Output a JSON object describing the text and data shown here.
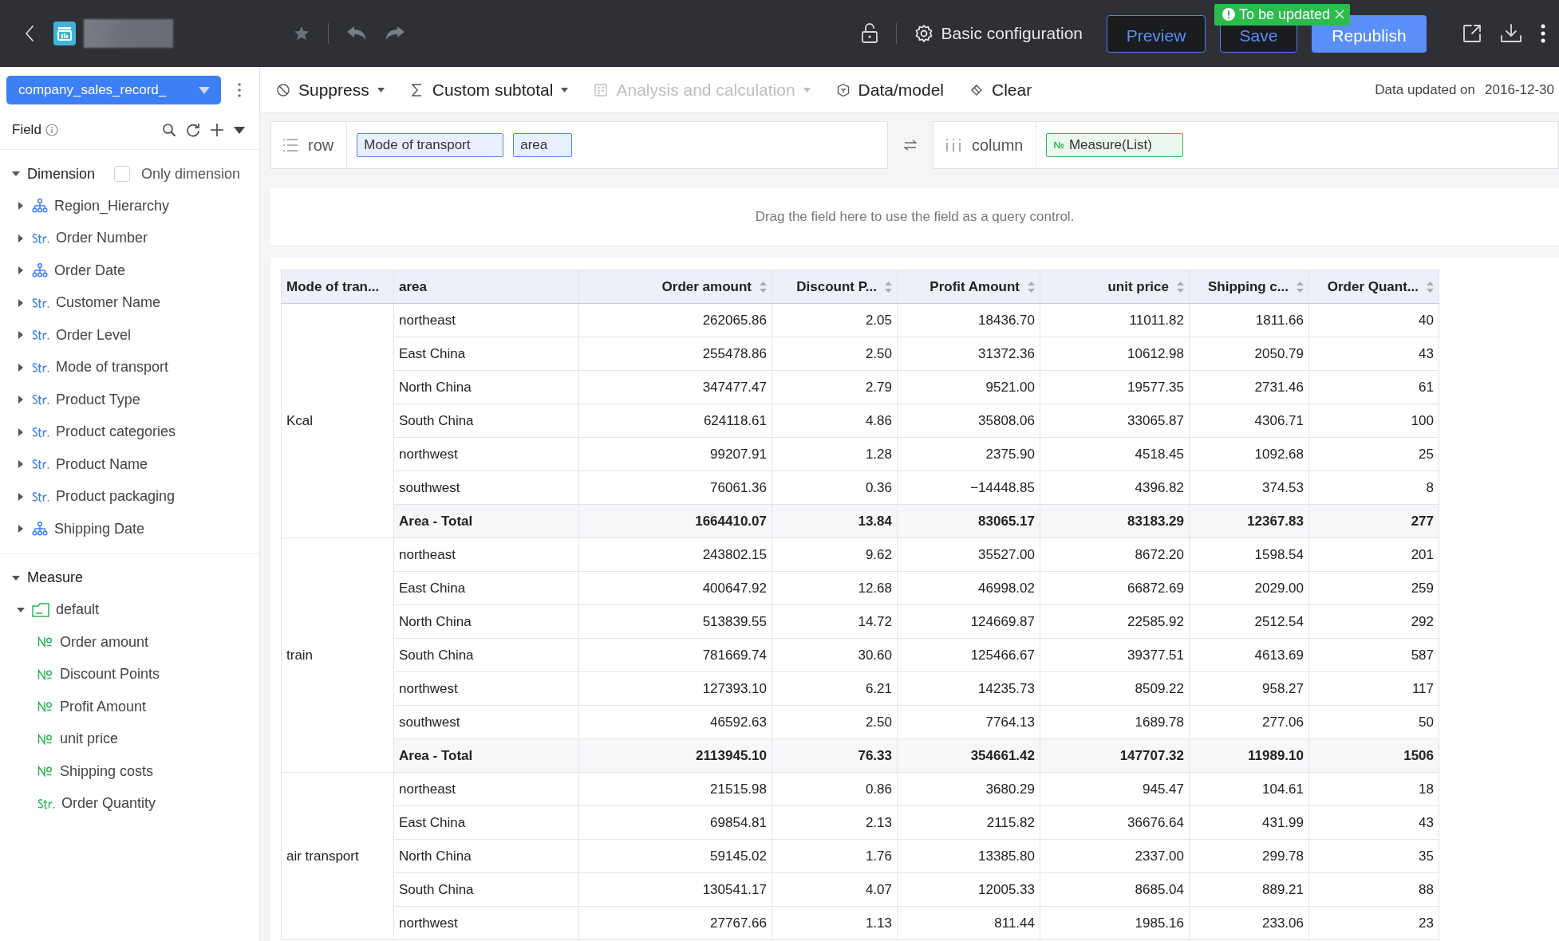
{
  "topbar": {
    "config_label": "Basic configuration",
    "buttons": [
      {
        "label": "Preview",
        "kind": "outline"
      },
      {
        "label": "Save",
        "kind": "outline"
      },
      {
        "label": "Republish",
        "kind": "primary"
      }
    ],
    "badge": "To be updated"
  },
  "sidebar": {
    "dataset": "company_sales_record_",
    "field_label": "Field",
    "sections": [
      {
        "label": "Dimension",
        "expanded": true,
        "option": {
          "label": "Only dimension",
          "checked": false
        },
        "items": [
          {
            "label": "Region_Hierarchy",
            "kind": "hierarchy",
            "expanded": false
          },
          {
            "label": "Order Number",
            "kind": "string",
            "expanded": false
          },
          {
            "label": "Order Date",
            "kind": "hierarchy",
            "expanded": false
          },
          {
            "label": "Customer Name",
            "kind": "string",
            "expanded": false
          },
          {
            "label": "Order Level",
            "kind": "string",
            "expanded": false
          },
          {
            "label": "Mode of transport",
            "kind": "string",
            "expanded": false
          },
          {
            "label": "Product Type",
            "kind": "string",
            "expanded": false
          },
          {
            "label": "Product categories",
            "kind": "string",
            "expanded": false
          },
          {
            "label": "Product Name",
            "kind": "string",
            "expanded": false
          },
          {
            "label": "Product packaging",
            "kind": "string",
            "expanded": false
          },
          {
            "label": "Shipping Date",
            "kind": "hierarchy",
            "expanded": false
          }
        ]
      },
      {
        "label": "Measure",
        "expanded": true,
        "items": [
          {
            "label": "default",
            "kind": "folder",
            "expanded": true,
            "children": [
              {
                "label": "Order amount",
                "kind": "number"
              },
              {
                "label": "Discount Points",
                "kind": "number"
              },
              {
                "label": "Profit Amount",
                "kind": "number"
              },
              {
                "label": "unit price",
                "kind": "number"
              },
              {
                "label": "Shipping costs",
                "kind": "number"
              },
              {
                "label": "Order Quantity",
                "kind": "string"
              }
            ]
          }
        ]
      }
    ]
  },
  "toolbar": {
    "items": [
      {
        "label": "Suppress",
        "kind": "suppress",
        "dropdown": true,
        "disabled": false
      },
      {
        "label": "Custom subtotal",
        "kind": "subtotal",
        "dropdown": true,
        "disabled": false
      },
      {
        "label": "Analysis and calculation",
        "kind": "analysis",
        "dropdown": true,
        "disabled": true
      },
      {
        "label": "Data/model",
        "kind": "model",
        "dropdown": false,
        "disabled": false
      },
      {
        "label": "Clear",
        "kind": "clear",
        "dropdown": false,
        "disabled": false
      }
    ],
    "updated_label": "Data updated on",
    "updated_date": "2016-12-30"
  },
  "shelves": [
    {
      "label": "row",
      "kind": "row",
      "chips": [
        {
          "label": "Mode of transport",
          "kind": "dimension"
        },
        {
          "label": "area",
          "kind": "dimension"
        }
      ]
    },
    {
      "label": "column",
      "kind": "column",
      "chips": [
        {
          "label": "Measure(List)",
          "kind": "measure",
          "badge": "№"
        }
      ]
    }
  ],
  "filter_zone": {
    "hint": "Drag the field here to use the field as a query control."
  },
  "table": {
    "columns": [
      {
        "label": "Mode of tran...",
        "sortable": false
      },
      {
        "label": "area",
        "sortable": false
      },
      {
        "label": "Order amount",
        "sortable": true
      },
      {
        "label": "Discount P...",
        "sortable": true
      },
      {
        "label": "Profit Amount",
        "sortable": true
      },
      {
        "label": "unit price",
        "sortable": true
      },
      {
        "label": "Shipping c...",
        "sortable": true
      },
      {
        "label": "Order Quant...",
        "sortable": true
      }
    ],
    "groups": [
      {
        "label": "Kcal",
        "rows": [
          {
            "kind": "data",
            "cells": [
              "northeast",
              "262065.86",
              "2.05",
              "18436.70",
              "11011.82",
              "1811.66",
              "40"
            ]
          },
          {
            "kind": "data",
            "cells": [
              "East China",
              "255478.86",
              "2.50",
              "31372.36",
              "10612.98",
              "2050.79",
              "43"
            ]
          },
          {
            "kind": "data",
            "cells": [
              "North China",
              "347477.47",
              "2.79",
              "9521.00",
              "19577.35",
              "2731.46",
              "61"
            ]
          },
          {
            "kind": "data",
            "cells": [
              "South China",
              "624118.61",
              "4.86",
              "35808.06",
              "33065.87",
              "4306.71",
              "100"
            ]
          },
          {
            "kind": "data",
            "cells": [
              "northwest",
              "99207.91",
              "1.28",
              "2375.90",
              "4518.45",
              "1092.68",
              "25"
            ]
          },
          {
            "kind": "data",
            "cells": [
              "southwest",
              "76061.36",
              "0.36",
              "−14448.85",
              "4396.82",
              "374.53",
              "8"
            ]
          },
          {
            "kind": "total",
            "cells": [
              "Area - Total",
              "1664410.07",
              "13.84",
              "83065.17",
              "83183.29",
              "12367.83",
              "277"
            ]
          }
        ]
      },
      {
        "label": "train",
        "rows": [
          {
            "kind": "data",
            "cells": [
              "northeast",
              "243802.15",
              "9.62",
              "35527.00",
              "8672.20",
              "1598.54",
              "201"
            ]
          },
          {
            "kind": "data",
            "cells": [
              "East China",
              "400647.92",
              "12.68",
              "46998.02",
              "66872.69",
              "2029.00",
              "259"
            ]
          },
          {
            "kind": "data",
            "cells": [
              "North China",
              "513839.55",
              "14.72",
              "124669.87",
              "22585.92",
              "2512.54",
              "292"
            ]
          },
          {
            "kind": "data",
            "cells": [
              "South China",
              "781669.74",
              "30.60",
              "125466.67",
              "39377.51",
              "4613.69",
              "587"
            ]
          },
          {
            "kind": "data",
            "cells": [
              "northwest",
              "127393.10",
              "6.21",
              "14235.73",
              "8509.22",
              "958.27",
              "117"
            ]
          },
          {
            "kind": "data",
            "cells": [
              "southwest",
              "46592.63",
              "2.50",
              "7764.13",
              "1689.78",
              "277.06",
              "50"
            ]
          },
          {
            "kind": "total",
            "cells": [
              "Area - Total",
              "2113945.10",
              "76.33",
              "354661.42",
              "147707.32",
              "11989.10",
              "1506"
            ]
          }
        ]
      },
      {
        "label": "air transport",
        "rows": [
          {
            "kind": "data",
            "cells": [
              "northeast",
              "21515.98",
              "0.86",
              "3680.29",
              "945.47",
              "104.61",
              "18"
            ]
          },
          {
            "kind": "data",
            "cells": [
              "East China",
              "69854.81",
              "2.13",
              "2115.82",
              "36676.64",
              "431.99",
              "43"
            ]
          },
          {
            "kind": "data",
            "cells": [
              "North China",
              "59145.02",
              "1.76",
              "13385.80",
              "2337.00",
              "299.78",
              "35"
            ]
          },
          {
            "kind": "data",
            "cells": [
              "South China",
              "130541.17",
              "4.07",
              "12005.33",
              "8685.04",
              "889.21",
              "88"
            ]
          },
          {
            "kind": "data",
            "cells": [
              "northwest",
              "27767.66",
              "1.13",
              "811.44",
              "1985.16",
              "233.06",
              "23"
            ]
          }
        ]
      }
    ]
  }
}
